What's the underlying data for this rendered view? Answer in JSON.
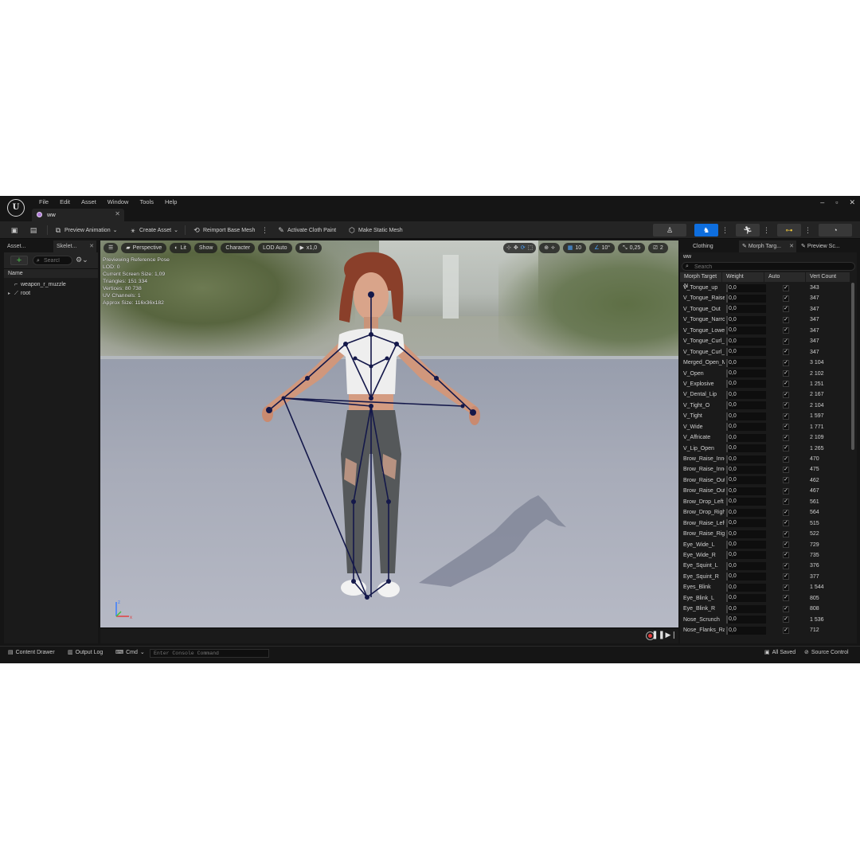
{
  "menu": [
    "File",
    "Edit",
    "Asset",
    "Window",
    "Tools",
    "Help"
  ],
  "tab": {
    "label": "ww"
  },
  "window_controls": [
    "–",
    "▫",
    "✕"
  ],
  "toolbar": {
    "preview_animation": "Preview Animation",
    "create_asset": "Create Asset",
    "reimport": "Reimport Base Mesh",
    "cloth_paint": "Activate Cloth Paint",
    "static_mesh": "Make Static Mesh"
  },
  "left": {
    "tab1": "Asset...",
    "tab2": "Skelet...",
    "search_placeholder": "Searcl",
    "header": "Name",
    "tree": [
      "weapon_r_muzzle",
      "root"
    ]
  },
  "viewport": {
    "perspective": "Perspective",
    "lit": "Lit",
    "show": "Show",
    "character": "Character",
    "lod": "LOD Auto",
    "speed": "x1,0",
    "grid": "10",
    "angle": "10°",
    "scale": "0,25",
    "cam": "2",
    "info": [
      "Previewing Reference Pose",
      "LOD: 0",
      "Current Screen Size: 1,09",
      "Triangles: 151 334",
      "Vertices: 80 738",
      "UV Channels: 1",
      "Approx Size: 116x36x182"
    ]
  },
  "right": {
    "tab_clothing": "Clothing",
    "tab_morph": "Morph Targ...",
    "tab_preview": "Preview Sc...",
    "asset": "ww",
    "search_placeholder": "Search",
    "headers": [
      "Morph Target N",
      "Weight",
      "Auto",
      "Vert Count"
    ],
    "rows": [
      {
        "name": "V_Tongue_up",
        "weight": "0,0",
        "count": "343"
      },
      {
        "name": "V_Tongue_Raise",
        "weight": "0,0",
        "count": "347"
      },
      {
        "name": "V_Tongue_Out",
        "weight": "0,0",
        "count": "347"
      },
      {
        "name": "V_Tongue_Narrow",
        "weight": "0,0",
        "count": "347"
      },
      {
        "name": "V_Tongue_Lower",
        "weight": "0,0",
        "count": "347"
      },
      {
        "name": "V_Tongue_Curl_U",
        "weight": "0,0",
        "count": "347"
      },
      {
        "name": "V_Tongue_Curl_D",
        "weight": "0,0",
        "count": "347"
      },
      {
        "name": "Merged_Open_Mouth",
        "weight": "0,0",
        "count": "3 104"
      },
      {
        "name": "V_Open",
        "weight": "0,0",
        "count": "2 102"
      },
      {
        "name": "V_Explosive",
        "weight": "0,0",
        "count": "1 251"
      },
      {
        "name": "V_Dental_Lip",
        "weight": "0,0",
        "count": "2 167"
      },
      {
        "name": "V_Tight_O",
        "weight": "0,0",
        "count": "2 104"
      },
      {
        "name": "V_Tight",
        "weight": "0,0",
        "count": "1 597"
      },
      {
        "name": "V_Wide",
        "weight": "0,0",
        "count": "1 771"
      },
      {
        "name": "V_Affricate",
        "weight": "0,0",
        "count": "2 109"
      },
      {
        "name": "V_Lip_Open",
        "weight": "0,0",
        "count": "1 265"
      },
      {
        "name": "Brow_Raise_Inner_L",
        "weight": "0,0",
        "count": "470"
      },
      {
        "name": "Brow_Raise_Inner_R",
        "weight": "0,0",
        "count": "475"
      },
      {
        "name": "Brow_Raise_Outer_L",
        "weight": "0,0",
        "count": "462"
      },
      {
        "name": "Brow_Raise_Outer_R",
        "weight": "0,0",
        "count": "467"
      },
      {
        "name": "Brow_Drop_Left",
        "weight": "0,0",
        "count": "561"
      },
      {
        "name": "Brow_Drop_Right",
        "weight": "0,0",
        "count": "564"
      },
      {
        "name": "Brow_Raise_Left",
        "weight": "0,0",
        "count": "515"
      },
      {
        "name": "Brow_Raise_Right",
        "weight": "0,0",
        "count": "522"
      },
      {
        "name": "Eye_Wide_L",
        "weight": "0,0",
        "count": "729"
      },
      {
        "name": "Eye_Wide_R",
        "weight": "0,0",
        "count": "735"
      },
      {
        "name": "Eye_Squint_L",
        "weight": "0,0",
        "count": "376"
      },
      {
        "name": "Eye_Squint_R",
        "weight": "0,0",
        "count": "377"
      },
      {
        "name": "Eyes_Blink",
        "weight": "0,0",
        "count": "1 544"
      },
      {
        "name": "Eye_Blink_L",
        "weight": "0,0",
        "count": "805"
      },
      {
        "name": "Eye_Blink_R",
        "weight": "0,0",
        "count": "808"
      },
      {
        "name": "Nose_Scrunch",
        "weight": "0,0",
        "count": "1 536"
      },
      {
        "name": "Nose_Flanks_Raise",
        "weight": "0,0",
        "count": "712"
      }
    ]
  },
  "statusbar": {
    "content_drawer": "Content Drawer",
    "output_log": "Output Log",
    "cmd": "Cmd",
    "console_placeholder": "Enter Console Command",
    "all_saved": "All Saved",
    "source_control": "Source Control"
  }
}
